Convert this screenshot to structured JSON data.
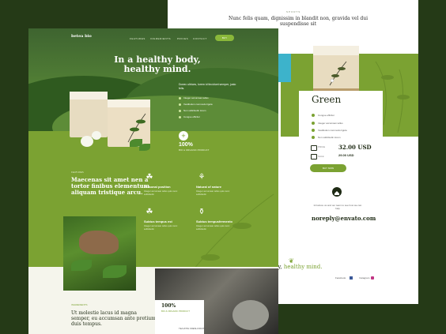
{
  "right_page": {
    "small_label": "SPORTS",
    "quote": "Nunc felis quam, dignissim in blandit non, gravida vel dui suspendisse sit",
    "product_title": "Green",
    "features": [
      "Integer accumsan tellus",
      "Vestibulum commodo ligula",
      "Non sollicitudin lorem",
      "Congue efficitur"
    ],
    "price_label": "PRICE",
    "price": "32.00 USD",
    "price2_label": "SALE",
    "price2": "29.00 USD",
    "buy_label": "BUY NOW",
    "contact_text": "Introduce us and our team to see how we can help",
    "email": "noreply@envato.com",
    "motto_prefix": "y body,",
    "motto_green": "healthy mind.",
    "links": [
      "Facebook",
      "Instagram"
    ]
  },
  "left_page": {
    "brand": "betea bio",
    "nav": [
      "FEATURES",
      "INGREDIENTS",
      "PRICES",
      "CONTACT"
    ],
    "nav_button": "BUY",
    "headline": "In a healthy body, healthy mind.",
    "hero_sub": "Donec ultrices, lorem id tincidunt semper, justo felis.",
    "hero_list": [
      "Integer accumsan tellus",
      "Vestibulum commodo ligula",
      "Non sollicitudin lorem",
      "Congue efficitur"
    ],
    "pct": "100%",
    "pct_label": "BIO & ORGANIC PRODUCT",
    "section_small": "FEATURES",
    "section_title": "Maecenas sit amet nen a tortor finibus elementum aliquam tristique arcu.",
    "features": [
      {
        "title": "Personal position",
        "desc": "Integer accumsan tellus quis nunc sollicitudin"
      },
      {
        "title": "Natural of nature",
        "desc": "Integer accumsan tellus quis nunc sollicitudin"
      },
      {
        "title": "Subtus tempus est",
        "desc": "Integer accumsan tellus quis nunc sollicitudin"
      },
      {
        "title": "Subtus tempusfermento",
        "desc": "Integer accumsan tellus quis nunc sollicitudin"
      }
    ],
    "bottom_small": "INGREDIENTS",
    "bottom_quote": "Ut molestie lacus id magna semper, eu accumsan ante pretium duis tempus.",
    "pct2": "100%",
    "pct2_label": "BIO & ORGANIC PRODUCT",
    "pct3_label": "TEA WITH FRESH FRUITS"
  },
  "colors": {
    "accent": "#7ba232",
    "dark": "#253a17",
    "cyan": "#3db3cb"
  }
}
